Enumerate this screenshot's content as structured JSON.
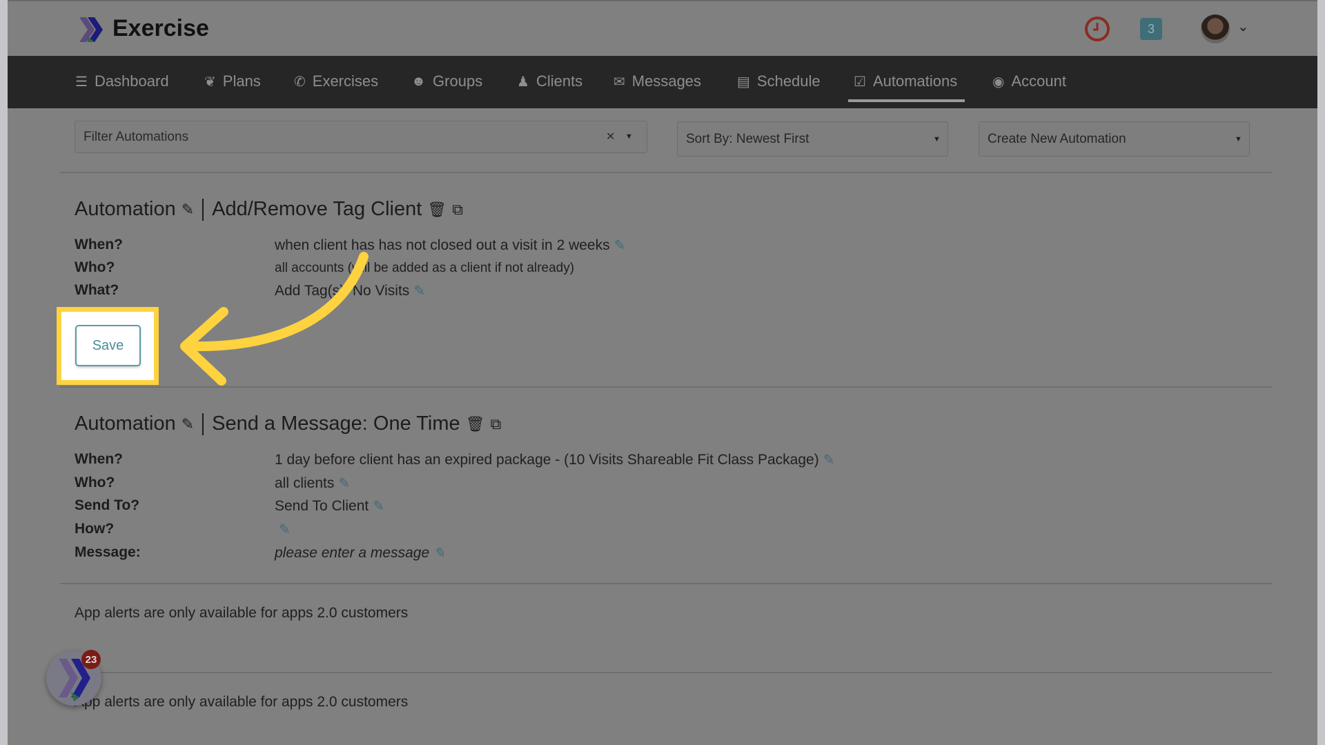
{
  "header": {
    "app_title": "Exercise",
    "notification_count": "3"
  },
  "nav": {
    "items": [
      {
        "label": "Dashboard",
        "icon": "list-icon"
      },
      {
        "label": "Plans",
        "icon": "twitter-bird-icon"
      },
      {
        "label": "Exercises",
        "icon": "phone-book-icon"
      },
      {
        "label": "Groups",
        "icon": "users-icon"
      },
      {
        "label": "Clients",
        "icon": "user-icon"
      },
      {
        "label": "Messages",
        "icon": "envelope-icon"
      },
      {
        "label": "Schedule",
        "icon": "book-icon"
      },
      {
        "label": "Automations",
        "icon": "checkbox-icon",
        "active": true
      },
      {
        "label": "Account",
        "icon": "user-circle-icon"
      }
    ]
  },
  "toolbar": {
    "filter_placeholder": "Filter Automations",
    "sort": "Sort By: Newest First",
    "create": "Create New Automation"
  },
  "automation1": {
    "prefix": "Automation",
    "title": "Add/Remove Tag Client",
    "rows": [
      {
        "label": "When?",
        "value": "when client has has not closed out a visit in 2 weeks"
      },
      {
        "label": "Who?",
        "value": "all accounts (will be added as a client if not already)"
      },
      {
        "label": "What?",
        "value": "Add Tag(s): No Visits"
      }
    ],
    "save": "Save"
  },
  "automation2": {
    "prefix": "Automation",
    "title": "Send a Message: One Time",
    "rows": [
      {
        "label": "When?",
        "value": "1 day before client has an expired package - (10 Visits Shareable Fit Class Package)"
      },
      {
        "label": "Who?",
        "value": "all clients"
      },
      {
        "label": "Send To?",
        "value": "Send To Client"
      },
      {
        "label": "How?",
        "value": ""
      },
      {
        "label": "Message:",
        "value": "please enter a message"
      }
    ]
  },
  "alerts": [
    "App alerts are only available for apps 2.0 customers",
    "App alerts are only available for apps 2.0 customers"
  ],
  "floating_widget": {
    "badge": "23"
  },
  "colors": {
    "highlight": "#ffd23f",
    "accent": "#4a8c9c",
    "nav_bg": "#262626"
  }
}
